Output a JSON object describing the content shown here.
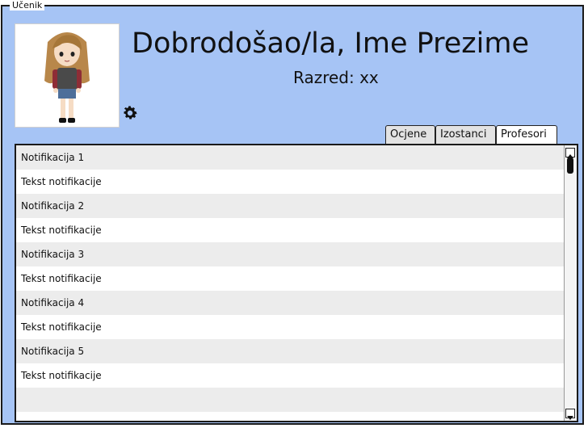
{
  "window": {
    "legend": "Učenik"
  },
  "header": {
    "welcome": "Dobrodošao/la, Ime Prezime",
    "grade": "Razred: xx"
  },
  "icons": {
    "settings": "gear-icon",
    "avatar": "student-avatar"
  },
  "tabs": [
    {
      "label": "Ocjene"
    },
    {
      "label": "Izostanci"
    },
    {
      "label": "Profesori",
      "active": true
    }
  ],
  "notifications": [
    {
      "title": "Notifikacija 1",
      "text": "Tekst notifikacije"
    },
    {
      "title": "Notifikacija 2",
      "text": "Tekst notifikacije"
    },
    {
      "title": "Notifikacija 3",
      "text": "Tekst notifikacije"
    },
    {
      "title": "Notifikacija 4",
      "text": "Tekst notifikacije"
    },
    {
      "title": "Notifikacija 5",
      "text": "Tekst notifikacije"
    }
  ],
  "colors": {
    "background": "#a6c4f5",
    "row_alt": "#ececec"
  }
}
